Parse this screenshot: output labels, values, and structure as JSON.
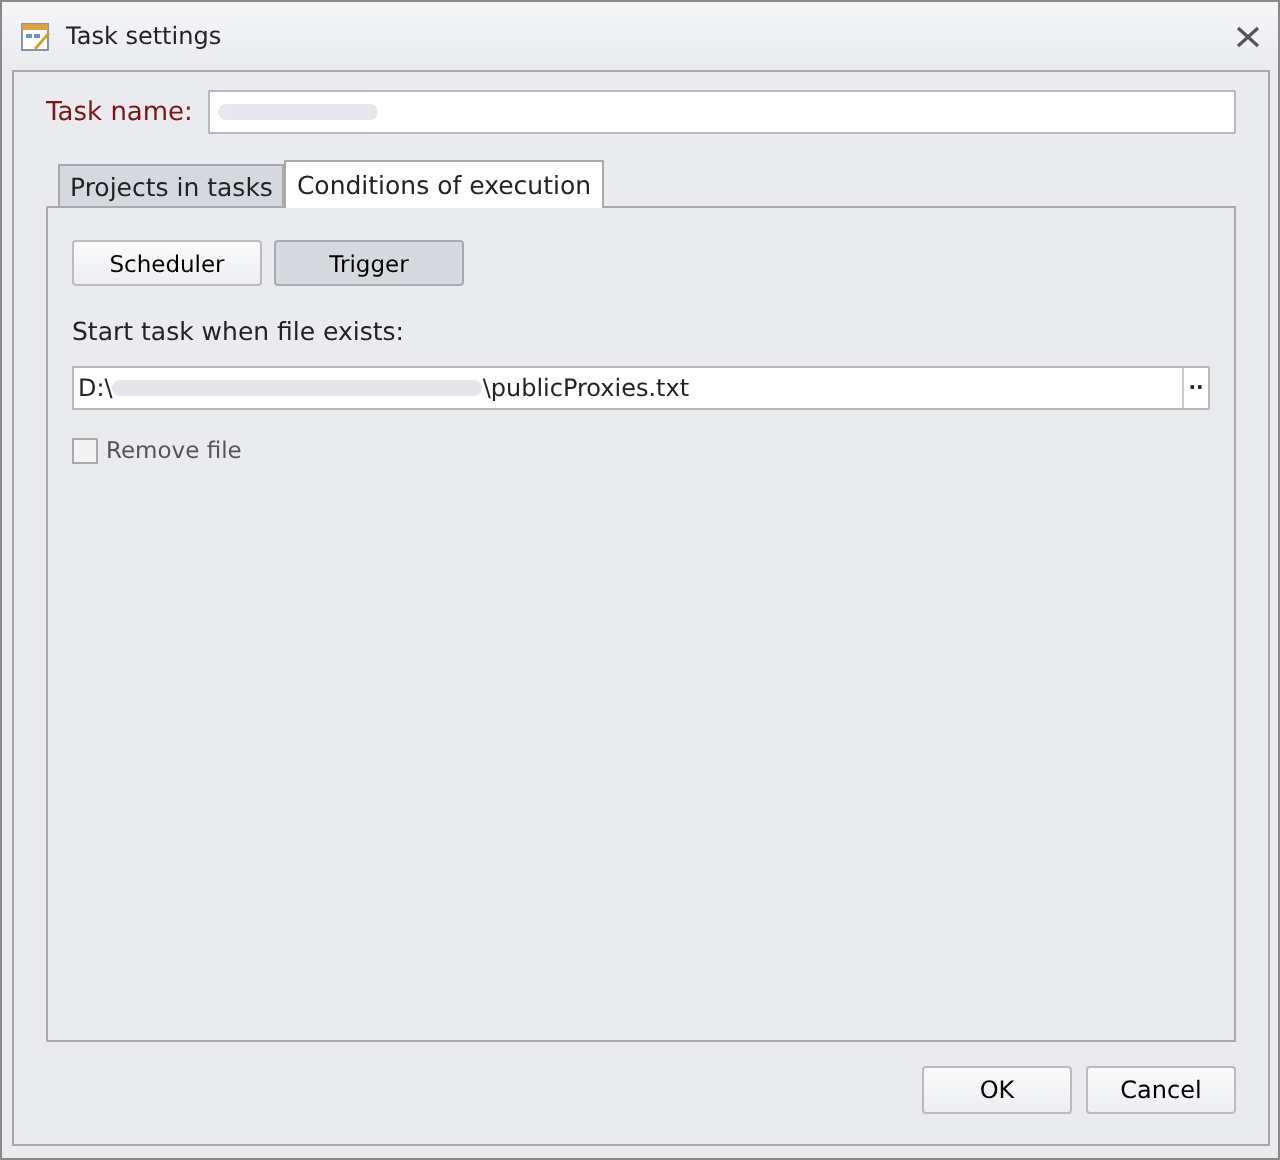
{
  "window": {
    "title": "Task settings"
  },
  "task_name": {
    "label": "Task name:"
  },
  "tabs": [
    {
      "label": "Projects in tasks",
      "selected": false
    },
    {
      "label": "Conditions of execution",
      "selected": true
    }
  ],
  "mode_buttons": [
    {
      "label": "Scheduler",
      "selected": false
    },
    {
      "label": "Trigger",
      "selected": true
    }
  ],
  "file_label": "Start task when file exists:",
  "file_path": {
    "start": "D:\\",
    "end": "\\publicProxies.txt",
    "browse": "··"
  },
  "remove_file": {
    "label": "Remove file",
    "checked": false
  },
  "buttons": [
    "OK",
    "Cancel"
  ]
}
